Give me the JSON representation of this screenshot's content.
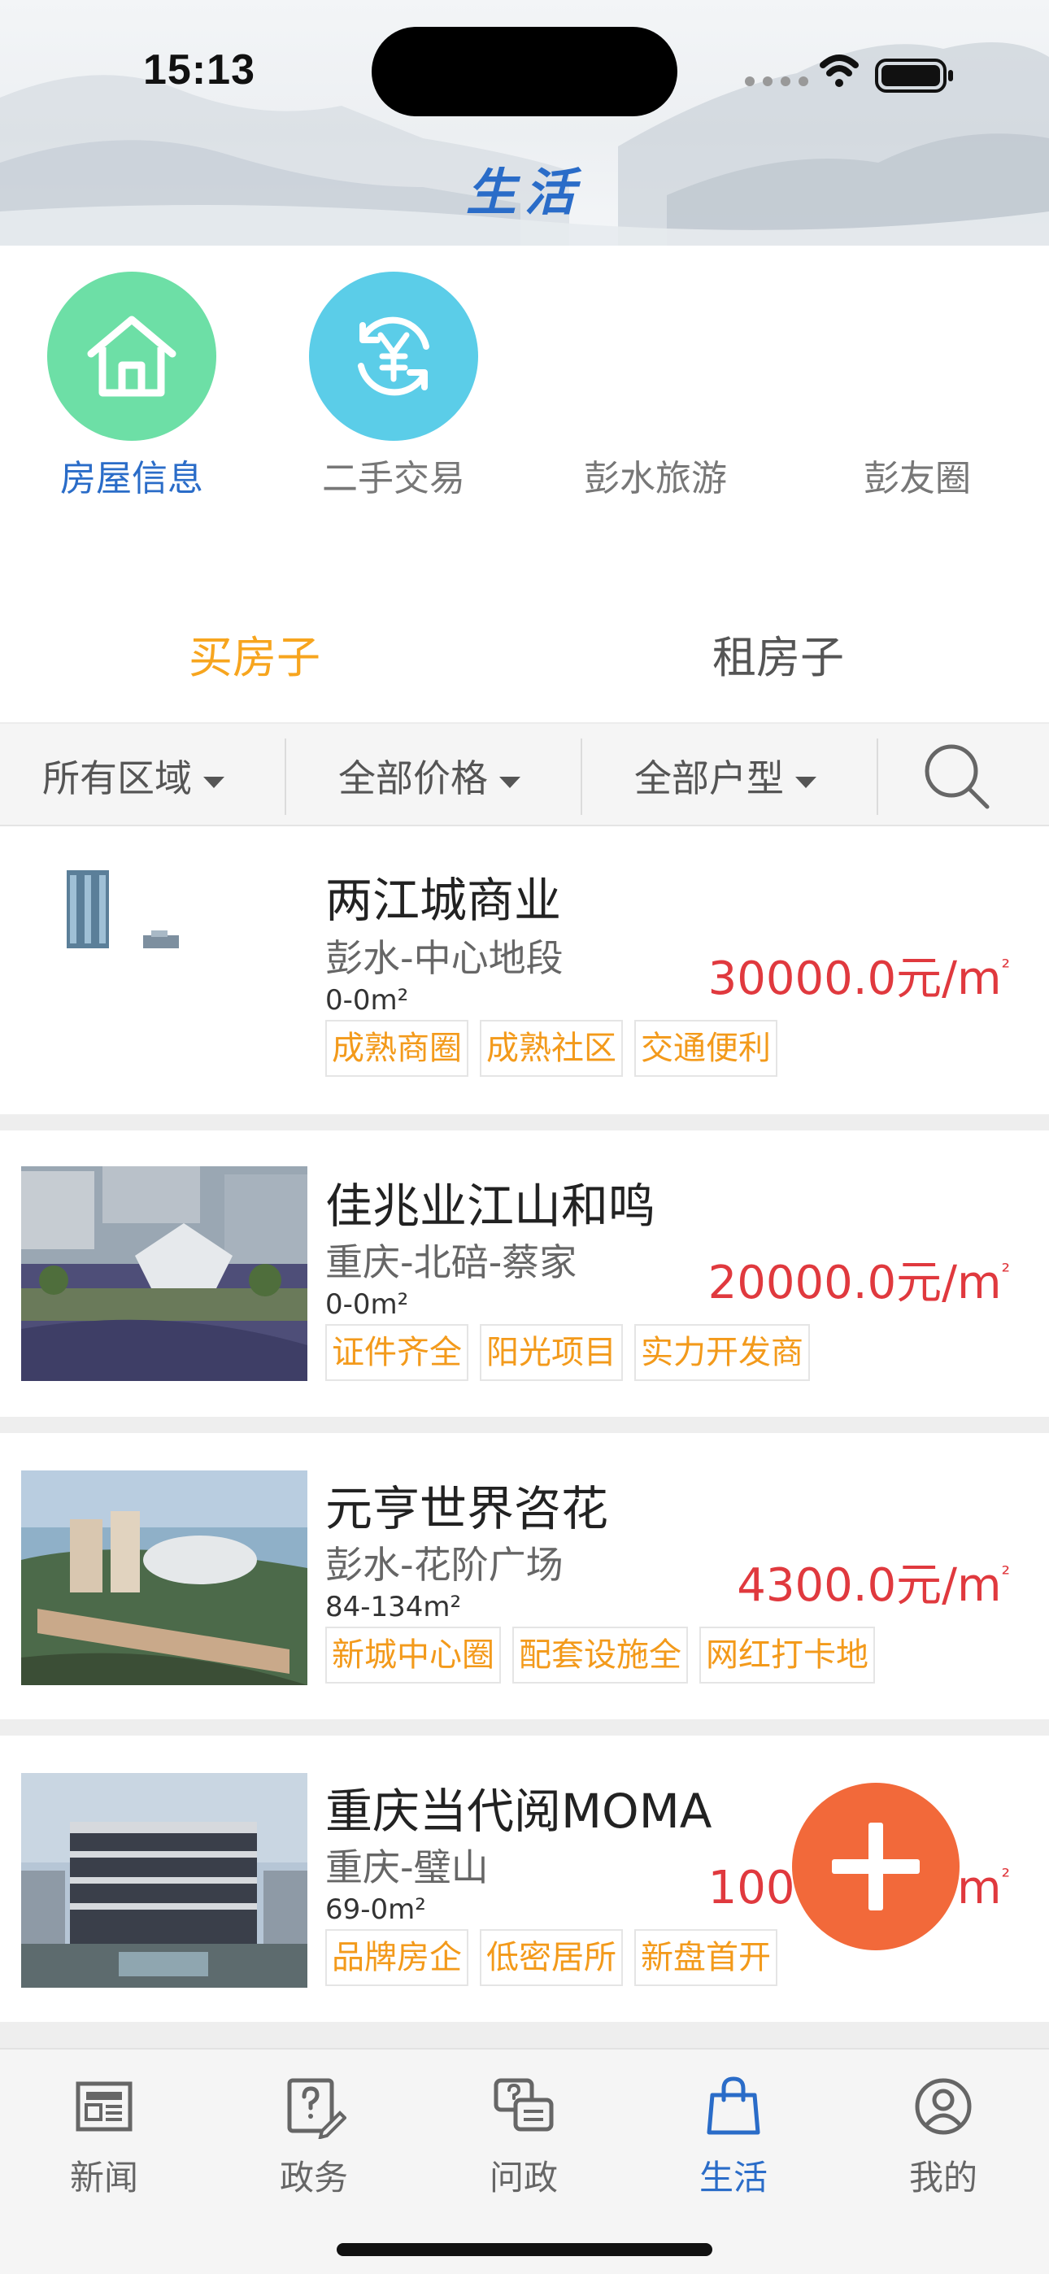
{
  "status_bar": {
    "time": "15:13"
  },
  "header": {
    "title": "生活"
  },
  "categories": [
    {
      "label": "房屋信息",
      "icon": "house-icon",
      "color": "#6ddfa6",
      "active": true
    },
    {
      "label": "二手交易",
      "icon": "yuan-exchange-icon",
      "color": "#5bcde8",
      "active": false
    },
    {
      "label": "彭水旅游",
      "icon": "",
      "active": false
    },
    {
      "label": "彭友圈",
      "icon": "",
      "active": false
    }
  ],
  "tabs": {
    "buy": "买房子",
    "rent": "租房子",
    "active": "buy"
  },
  "filters": {
    "region": "所有区域",
    "price": "全部价格",
    "layout": "全部户型"
  },
  "listings": [
    {
      "title": "两江城商业",
      "location": "彭水-中心地段",
      "area": "0-0m²",
      "price": "30000.0元/m",
      "price_sup": "²",
      "tags": [
        "成熟商圈",
        "成熟社区",
        "交通便利"
      ]
    },
    {
      "title": "佳兆业江山和鸣",
      "location": "重庆-北碚-蔡家",
      "area": "0-0m²",
      "price": "20000.0元/m",
      "price_sup": "²",
      "tags": [
        "证件齐全",
        "阳光项目",
        "实力开发商"
      ]
    },
    {
      "title": "元亨世界咨花",
      "location": "彭水-花阶广场",
      "area": "84-134m²",
      "price": "4300.0元/m",
      "price_sup": "²",
      "tags": [
        "新城中心圈",
        "配套设施全",
        "网红打卡地"
      ]
    },
    {
      "title": "重庆当代阅MOMA",
      "location": "重庆-璧山",
      "area": "69-0m²",
      "price": "10000.0元/m",
      "price_sup": "²",
      "tags": [
        "品牌房企",
        "低密居所",
        "新盘首开"
      ]
    }
  ],
  "bottom_nav": [
    {
      "label": "新闻",
      "icon": "newspaper-icon",
      "active": false
    },
    {
      "label": "政务",
      "icon": "question-edit-icon",
      "active": false
    },
    {
      "label": "问政",
      "icon": "chat-question-icon",
      "active": false
    },
    {
      "label": "生活",
      "icon": "shopping-bag-icon",
      "active": true
    },
    {
      "label": "我的",
      "icon": "user-profile-icon",
      "active": false
    }
  ],
  "colors": {
    "accent_blue": "#2a6cc8",
    "tab_active": "#f7a51e",
    "price_red": "#e0393e",
    "tag_orange": "#f39a1b",
    "fab": "#f2693a"
  }
}
